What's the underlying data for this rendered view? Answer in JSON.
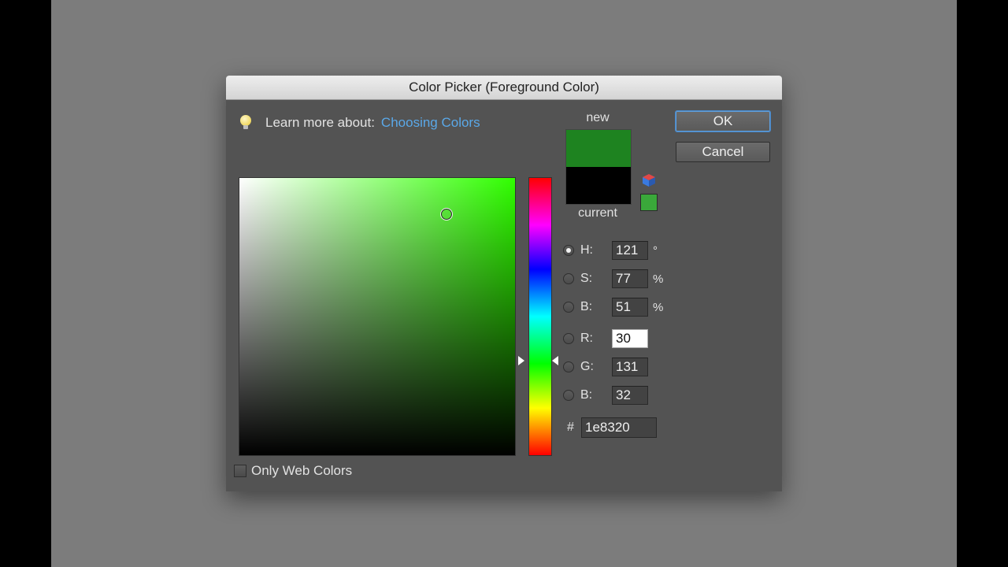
{
  "dialog": {
    "title": "Color Picker (Foreground Color)",
    "learn_prefix": "Learn more about:",
    "learn_link": "Choosing Colors"
  },
  "swatches": {
    "new_label": "new",
    "current_label": "current",
    "new_color": "#1e8320",
    "current_color": "#000000"
  },
  "buttons": {
    "ok": "OK",
    "cancel": "Cancel"
  },
  "fields": {
    "h": {
      "label": "H:",
      "value": "121",
      "unit": "°",
      "selected": true
    },
    "s": {
      "label": "S:",
      "value": "77",
      "unit": "%"
    },
    "bri": {
      "label": "B:",
      "value": "51",
      "unit": "%"
    },
    "r": {
      "label": "R:",
      "value": "30"
    },
    "g": {
      "label": "G:",
      "value": "131"
    },
    "b": {
      "label": "B:",
      "value": "32"
    },
    "hex_symbol": "#",
    "hex": "1e8320"
  },
  "options": {
    "only_web_colors": "Only Web Colors",
    "only_web_colors_checked": false
  },
  "colors": {
    "hue_field_color": "#30ff00",
    "websafe_swatch": "#3aa83a",
    "link": "#5aa8e8"
  },
  "icons": [
    "lightbulb-icon",
    "color-cube-icon"
  ]
}
